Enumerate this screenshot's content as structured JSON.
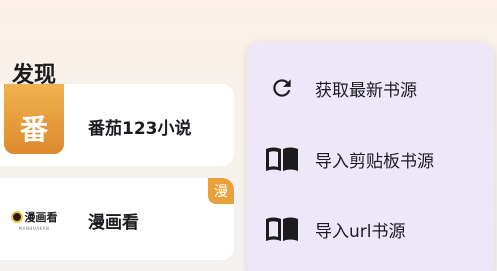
{
  "header": {
    "title": "发现"
  },
  "sources": [
    {
      "name": "番茄123小说",
      "logo_text": "番",
      "badge": ""
    },
    {
      "name": "漫画看",
      "logo_text": "漫画看",
      "logo_subtext": "MANHUAKAN",
      "badge": "漫"
    }
  ],
  "menu": {
    "items": [
      {
        "label": "获取最新书源",
        "icon": "refresh-icon"
      },
      {
        "label": "导入剪贴板书源",
        "icon": "book-icon"
      },
      {
        "label": "导入url书源",
        "icon": "book-icon"
      }
    ]
  },
  "colors": {
    "menu_bg": "#ede7f8",
    "badge": "#e9a23b",
    "text": "#1c1b1f"
  }
}
